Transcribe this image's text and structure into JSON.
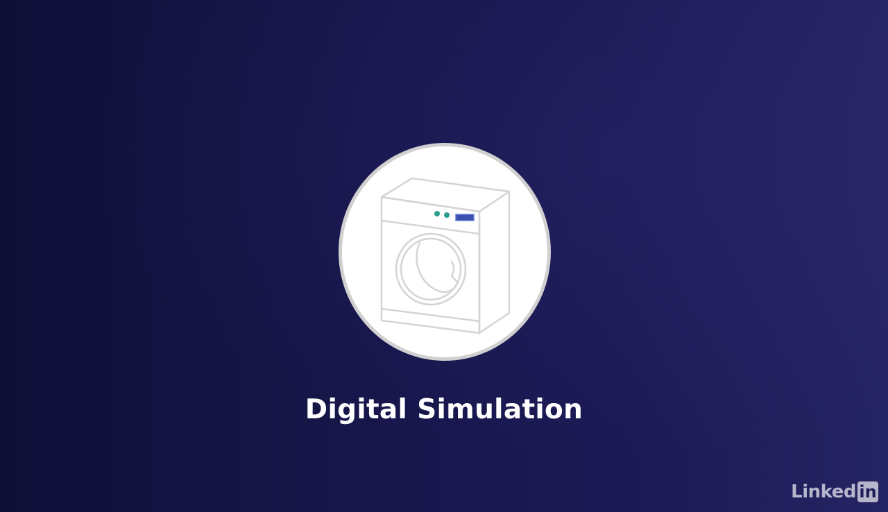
{
  "slide": {
    "title": "Digital Simulation",
    "icon": "washing-machine-icon",
    "colors": {
      "background_left": "#100f38",
      "background_right": "#252463",
      "circle_fill": "#ffffff",
      "circle_border": "#d0d0d0",
      "line_art": "#d4d4d4",
      "indicator_lights": "#2a9d8f",
      "display_panel": "#3a4fb0"
    }
  },
  "branding": {
    "logo_text": "Linked",
    "logo_badge": "in"
  }
}
